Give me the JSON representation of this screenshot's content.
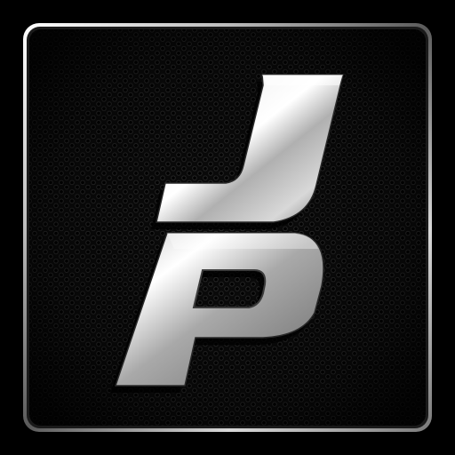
{
  "icon": {
    "logo_text": "JP",
    "logo_letter_top": "J",
    "logo_letter_bottom": "P",
    "style": "metallic-chrome-on-hex-mesh",
    "colors": {
      "background": "#000000",
      "frame_light": "#f2f2f2",
      "frame_dark": "#3a3a3a",
      "panel": "#0c0c0c",
      "chrome_light": "#f4f4f4",
      "chrome_mid": "#a8a8a8",
      "chrome_dark": "#5a5a5a",
      "shadow": "#000000"
    }
  }
}
